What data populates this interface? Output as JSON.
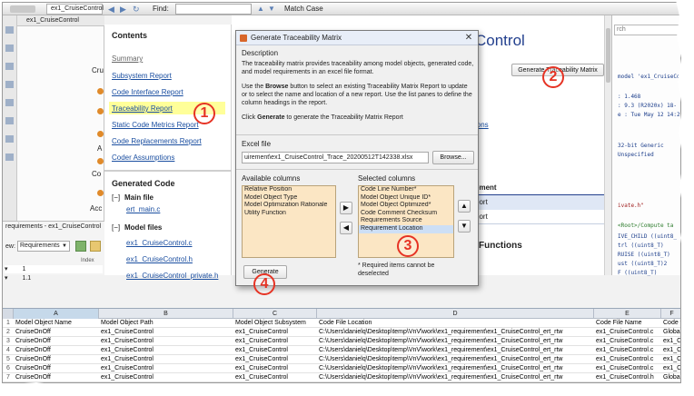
{
  "toolbar": {
    "tab_title": "ex1_CruiseControl",
    "find_label": "Find:",
    "match_case": "Match Case"
  },
  "model_browser": {
    "breadcrumb": "ex1_CruiseControl",
    "frag_cru": "Cru",
    "frag_a": "A",
    "frag_co": "Co",
    "frag_acc": "Acc"
  },
  "bottom_panel": {
    "title": "requirements - ex1_CruiseControl",
    "view_label": "ew:",
    "view_value": "Requirements",
    "index_label": "Index",
    "row_1": "1",
    "row_2": "1.1"
  },
  "report": {
    "heading": "Contents",
    "links": [
      "Summary",
      "Subsystem Report",
      "Code Interface Report",
      "Traceability Report",
      "Static Code Metrics Report",
      "Code Replacements Report",
      "Coder Assumptions"
    ],
    "generated_code": "Generated Code",
    "main_file": "Main file",
    "main_link": "ert_main.c",
    "model_files": "Model files",
    "model_links": [
      "ex1_CruiseControl.c",
      "ex1_CruiseControl.h",
      "ex1_CruiseControl_private.h"
    ],
    "title_fragment": "Control",
    "generate_button": "Generate Traceability Matrix",
    "frag_ions": "ions",
    "frag_ement": "ement",
    "frag_port1": "port",
    "frag_port2": "port",
    "frag_functions": "Functions"
  },
  "code_view": {
    "search_placeholder": "rch",
    "lines": [
      "model 'ex1_CruiseCo",
      ": 1.468",
      ": 9.3 (R2020x) 18-",
      "e : Tue May 12 14:2",
      "32-bit Generic",
      "Unspecified",
      "ivate.h\"",
      "<Root>/Compute ta",
      "IVE_CHILD ((uint8_",
      "trl     ((uint8_T)",
      "RUISE    ((uint8_T)",
      "ust     ((uint8_T)2",
      "F       ((uint8_T)",
      "        ((uint8_T)"
    ]
  },
  "dialog": {
    "title": "Generate Traceability Matrix",
    "description_label": "Description",
    "paragraph_1": "The traceability matrix provides traceability among model objects, generated code, and model requirements in an excel file format.",
    "paragraph_2_pre": "Use the ",
    "paragraph_2_bold": "Browse",
    "paragraph_2_post": " button to select an existing Traceability Matrix Report to update or to select the name and location of a new report. Use the list panes to define the column headings in the report.",
    "paragraph_3_pre": "Click ",
    "paragraph_3_bold": "Generate",
    "paragraph_3_post": " to generate the Traceability Matrix Report",
    "excel_label": "Excel file",
    "excel_value": "uirement\\ex1_CruiseControl_Trace_20200512T142338.xlsx",
    "browse_button": "Browse...",
    "available_label": "Available columns",
    "available": [
      "Relative Position",
      "Model Object Type",
      "Model Optimization Rationale",
      "Utility Function"
    ],
    "selected_label": "Selected columns",
    "selected": [
      "Code Line Number*",
      "Model Object Unique ID*",
      "Model Object Optimized*",
      "Code Comment Checksum",
      "Requirements Source",
      "Requirement Location"
    ],
    "note": "* Required items cannot be deselected",
    "generate_button": "Generate"
  },
  "badges": [
    "1",
    "2",
    "3",
    "4"
  ],
  "spreadsheet": {
    "columns": [
      "A",
      "B",
      "C",
      "D",
      "E"
    ],
    "col_f": "F",
    "rows": [
      [
        "1",
        "Model Object Name",
        "Model Object Path",
        "Model Object Subsystem",
        "Code File Location",
        "Code File Name",
        "Code f"
      ],
      [
        "2",
        "CruiseOnOff",
        "ex1_CruiseControl",
        "ex1_CruiseControl",
        "C:\\Users\\danielq\\Desktop\\temp\\VnV\\work\\ex1_requirement\\ex1_CruiseControl_ert_rtw",
        "ex1_CruiseControl.c",
        "Global"
      ],
      [
        "3",
        "CruiseOnOff",
        "ex1_CruiseControl",
        "ex1_CruiseControl",
        "C:\\Users\\danielq\\Desktop\\temp\\VnV\\work\\ex1_requirement\\ex1_CruiseControl_ert_rtw",
        "ex1_CruiseControl.c",
        "ex1_C"
      ],
      [
        "4",
        "CruiseOnOff",
        "ex1_CruiseControl",
        "ex1_CruiseControl",
        "C:\\Users\\danielq\\Desktop\\temp\\VnV\\work\\ex1_requirement\\ex1_CruiseControl_ert_rtw",
        "ex1_CruiseControl.c",
        "ex1_C"
      ],
      [
        "5",
        "CruiseOnOff",
        "ex1_CruiseControl",
        "ex1_CruiseControl",
        "C:\\Users\\danielq\\Desktop\\temp\\VnV\\work\\ex1_requirement\\ex1_CruiseControl_ert_rtw",
        "ex1_CruiseControl.c",
        "ex1_C"
      ],
      [
        "6",
        "CruiseOnOff",
        "ex1_CruiseControl",
        "ex1_CruiseControl",
        "C:\\Users\\danielq\\Desktop\\temp\\VnV\\work\\ex1_requirement\\ex1_CruiseControl_ert_rtw",
        "ex1_CruiseControl.c",
        "ex1_C"
      ],
      [
        "7",
        "CruiseOnOff",
        "ex1_CruiseControl",
        "ex1_CruiseControl",
        "C:\\Users\\danielq\\Desktop\\temp\\VnV\\work\\ex1_requirement\\ex1_CruiseControl_ert_rtw",
        "ex1_CruiseControl.h",
        "Global"
      ]
    ]
  },
  "colors": {
    "accent": "#e63324",
    "highlight": "#ffff99",
    "link": "#1a4ea0",
    "dialog_header": "#e8eef8",
    "list_bg": "#fbe6c4"
  }
}
